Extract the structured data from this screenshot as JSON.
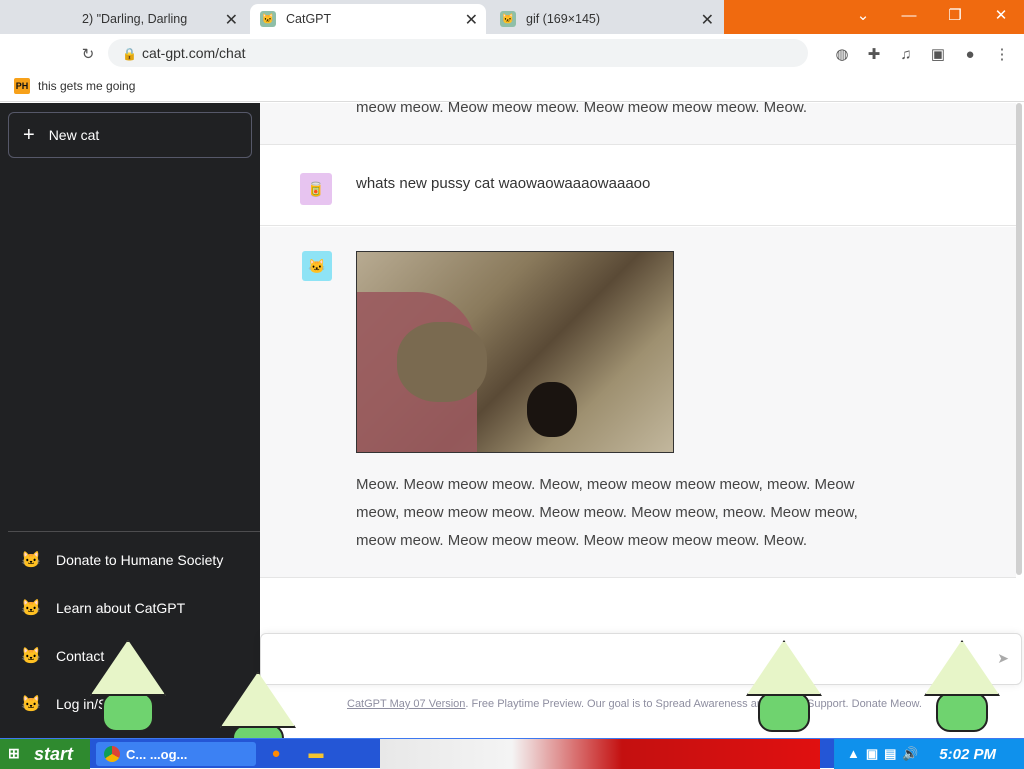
{
  "browser": {
    "tabs": [
      {
        "title": "2) \"Darling, Darling",
        "active": false
      },
      {
        "title": "CatGPT",
        "active": true
      },
      {
        "title": "gif (169×145)",
        "active": false
      }
    ],
    "url": "cat-gpt.com/chat",
    "bookmark": {
      "icon_text": "PH",
      "label": "this gets me going"
    }
  },
  "sidebar": {
    "new_button": "New cat",
    "links": [
      "Donate to Humane Society",
      "Learn about CatGPT",
      "Contact",
      "Log in/Sign up"
    ]
  },
  "chat": {
    "previous_tail": "meow meow. Meow meow meow. Meow meow meow meow. Meow.",
    "user_message": "whats new pussy cat waowaowaaaowaaaoo",
    "bot_image_alt": "cat gif",
    "bot_message": "Meow. Meow meow meow. Meow, meow meow meow meow, meow. Meow meow, meow meow meow. Meow meow. Meow meow, meow. Meow meow, meow meow. Meow meow meow. Meow meow meow meow. Meow."
  },
  "input": {
    "placeholder": ""
  },
  "footer": {
    "version_link": "CatGPT May 07 Version",
    "text": ". Free Playtime Preview. Our goal is to Spread Awareness and Cause Support. Donate Meow."
  },
  "taskbar": {
    "start_label": "start",
    "task_label": "C... ...og...",
    "clock": "5:02 PM"
  }
}
